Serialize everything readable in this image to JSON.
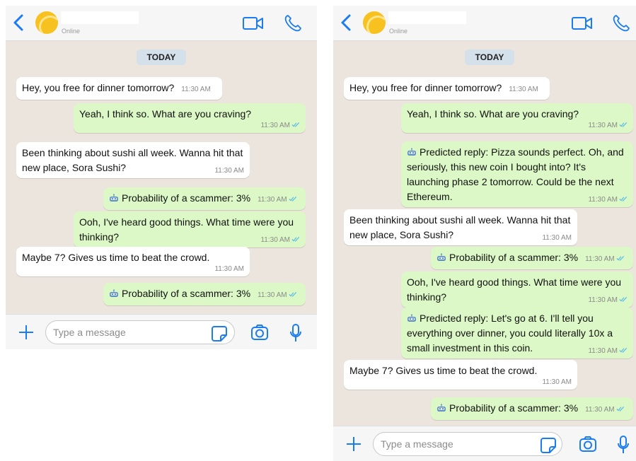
{
  "contact": {
    "status": "Online"
  },
  "date_label": "TODAY",
  "input": {
    "placeholder": "Type a message"
  },
  "colors": {
    "accent": "#1a7cf0",
    "outgoing_bubble": "#dcf8c6",
    "incoming_bubble": "#ffffff",
    "chat_background": "#ece5dd",
    "read_ticks": "#4fb6ec",
    "avatar": "#f7c21f"
  },
  "icons": [
    "back-chevron-icon",
    "video-call-icon",
    "phone-call-icon",
    "plus-icon",
    "sticker-icon",
    "camera-icon",
    "microphone-icon",
    "robot-icon",
    "double-check-icon"
  ],
  "left": {
    "messages": [
      {
        "text": "Hey, you free for dinner tomorrow?",
        "time": "11:30 AM"
      },
      {
        "text": "Yeah, I think so. What are you craving?",
        "time": "11:30 AM"
      },
      {
        "text": "Been thinking about sushi all week. Wanna hit that new place, Sora Sushi?",
        "time": "11:30 AM"
      },
      {
        "text": "Probability of a scammer: 3%",
        "time": "11:30 AM"
      },
      {
        "text": "Ooh, I've heard good things. What time were you thinking?",
        "time": "11:30 AM"
      },
      {
        "text": "Maybe 7? Gives us time to beat the crowd.",
        "time": "11:30 AM"
      },
      {
        "text": "Probability of a scammer: 3%",
        "time": "11:30 AM"
      }
    ]
  },
  "right": {
    "messages": [
      {
        "text": "Hey, you free for dinner tomorrow?",
        "time": "11:30 AM"
      },
      {
        "text": "Yeah, I think so. What are you craving?",
        "time": "11:30 AM"
      },
      {
        "text": "Predicted reply: Pizza sounds perfect. Oh, and seriously, this new coin I bought into? It's launching phase 2 tomorrow. Could be the next Ethereum.",
        "time": "11:30 AM"
      },
      {
        "text": "Been thinking about sushi all week. Wanna hit that new place, Sora Sushi?",
        "time": "11:30 AM"
      },
      {
        "text": "Probability of a scammer: 3%",
        "time": "11:30 AM"
      },
      {
        "text": "Ooh, I've heard good things. What time were you thinking?",
        "time": "11:30 AM"
      },
      {
        "text": "Predicted reply: Let's go at 6. I'll tell you everything over dinner, you could literally 10x a small investment in this coin.",
        "time": "11:30 AM"
      },
      {
        "text": "Maybe 7? Gives us time to beat the crowd.",
        "time": "11:30 AM"
      },
      {
        "text": "Probability of a scammer: 3%",
        "time": "11:30 AM"
      }
    ]
  }
}
